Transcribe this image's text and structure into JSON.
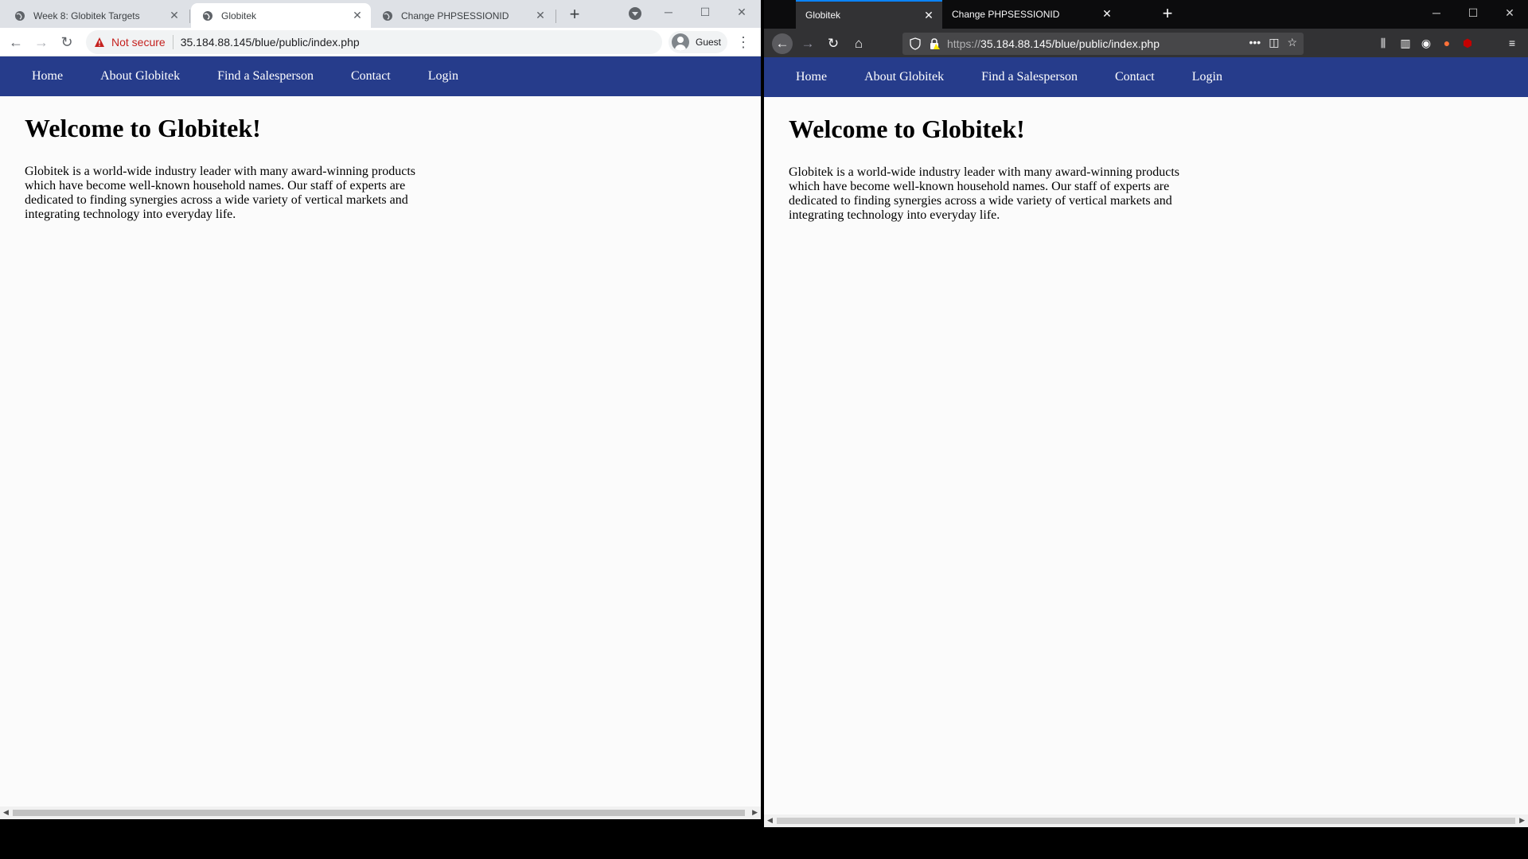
{
  "left_browser": {
    "tabs": [
      {
        "title": "Week 8: Globitek Targets",
        "active": false
      },
      {
        "title": "Globitek",
        "active": true
      },
      {
        "title": "Change PHPSESSIONID",
        "active": false
      }
    ],
    "security_label": "Not secure",
    "url": "35.184.88.145/blue/public/index.php",
    "profile_label": "Guest"
  },
  "right_browser": {
    "tabs": [
      {
        "title": "Globitek",
        "active": true
      },
      {
        "title": "Change PHPSESSIONID",
        "active": false
      }
    ],
    "url_scheme": "https://",
    "url_rest": "35.184.88.145/blue/public/index.php"
  },
  "site": {
    "nav": [
      "Home",
      "About Globitek",
      "Find a Salesperson",
      "Contact",
      "Login"
    ],
    "heading": "Welcome to Globitek!",
    "body": "Globitek is a world-wide industry leader with many award-winning products which have become well-known household names. Our staff of experts are dedicated to finding synergies across a wide variety of vertical markets and integrating technology into everyday life."
  },
  "colors": {
    "site_nav_bg": "#263c8b",
    "chrome_tabstrip": "#dee1e6",
    "firefox_tabstrip": "#0c0c0d",
    "firefox_toolbar": "#323234",
    "firefox_accent": "#0a84ff",
    "not_secure_red": "#c5221f"
  }
}
